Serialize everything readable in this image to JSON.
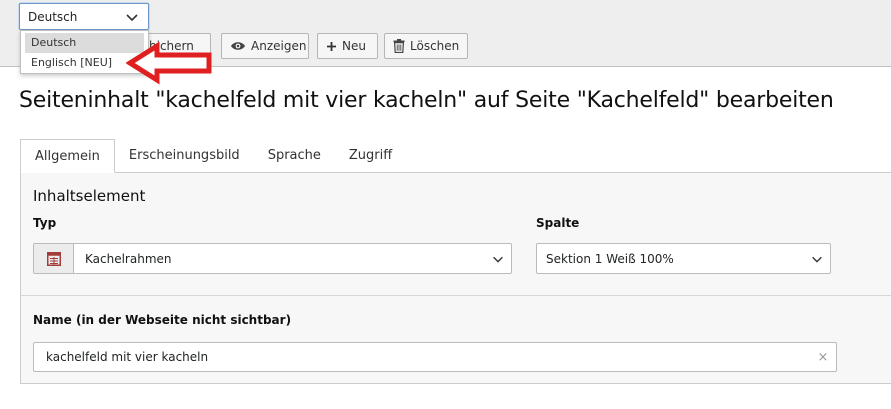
{
  "language": {
    "selected": "Deutsch",
    "options": [
      "Deutsch",
      "Englisch [NEU]"
    ]
  },
  "toolbar": {
    "save_label": "Speichern",
    "save_visible": "hichern",
    "view_label": "Anzeigen",
    "new_label": "Neu",
    "delete_label": "Löschen"
  },
  "page_title": "Seiteninhalt \"kachelfeld mit vier kacheln\" auf Seite \"Kachelfeld\" bearbeiten",
  "tabs": [
    "Allgemein",
    "Erscheinungsbild",
    "Sprache",
    "Zugriff"
  ],
  "form": {
    "section_title": "Inhaltselement",
    "type_label": "Typ",
    "type_value": "Kachelrahmen",
    "column_label": "Spalte",
    "column_value": "Sektion 1 Weiß 100%",
    "name_label": "Name (in der Webseite nicht sichtbar)",
    "name_value": "kachelfeld mit vier kacheln",
    "clear_symbol": "×"
  },
  "colors": {
    "annotation_arrow": "#e02020",
    "type_icon": "#a43b3b",
    "focus_border": "#6e98c9"
  },
  "icons": {
    "view": "eye-icon",
    "new": "plus-icon",
    "delete": "trash-icon",
    "type": "tile-frame-icon",
    "chevron": "chevron-down-icon"
  }
}
